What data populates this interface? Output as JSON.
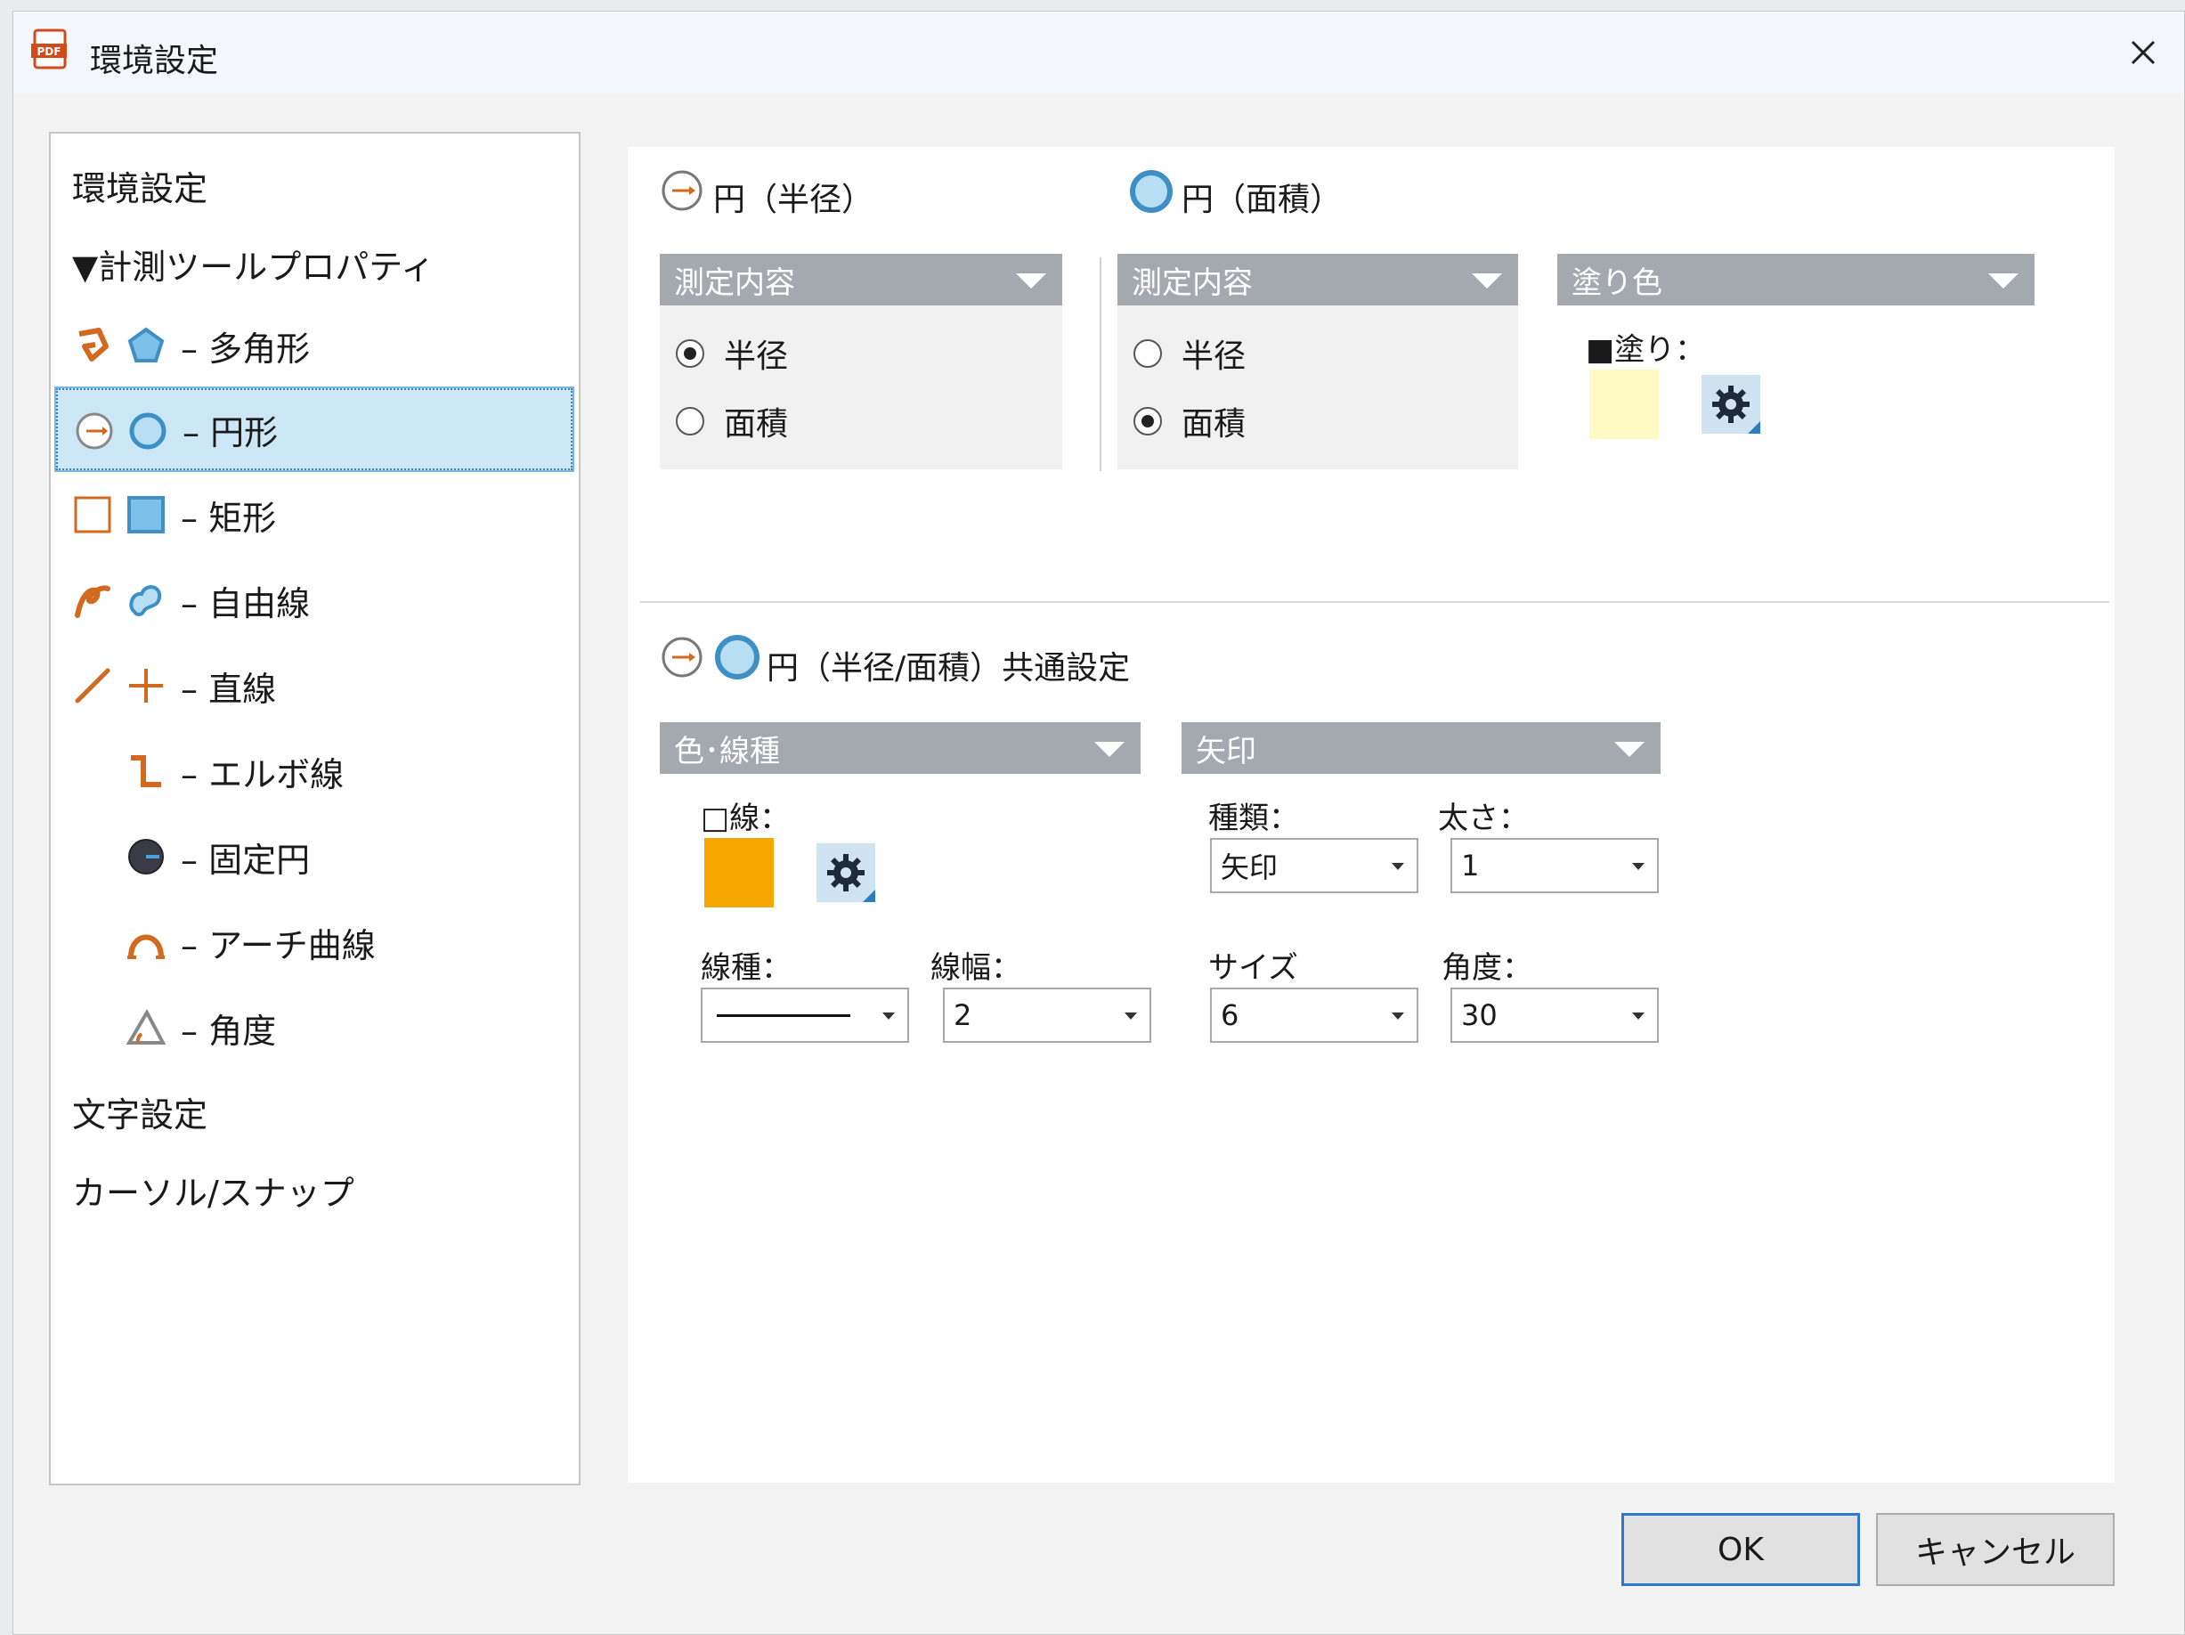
{
  "window": {
    "title": "環境設定"
  },
  "tree": {
    "items": [
      {
        "label": "環境設定"
      },
      {
        "label": "▼計測ツールプロパティ"
      },
      {
        "label": "– 多角形"
      },
      {
        "label": "– 円形"
      },
      {
        "label": "– 矩形"
      },
      {
        "label": "– 自由線"
      },
      {
        "label": "– 直線"
      },
      {
        "label": "– エルボ線"
      },
      {
        "label": "– 固定円"
      },
      {
        "label": "– アーチ曲線"
      },
      {
        "label": "– 角度"
      },
      {
        "label": "文字設定"
      },
      {
        "label": "カーソル/スナップ"
      }
    ]
  },
  "radius_section": {
    "title": "円（半径）",
    "header": "測定内容",
    "options": [
      "半径",
      "面積"
    ],
    "selected": "半径"
  },
  "area_section": {
    "title": "円（面積）",
    "header": "測定内容",
    "options": [
      "半径",
      "面積"
    ],
    "selected": "面積"
  },
  "fill_section": {
    "header": "塗り色",
    "fill_label": "■塗り：",
    "fill_color": "#fff9c4"
  },
  "common_section": {
    "title": "円（半径/面積）共通設定",
    "color_group": {
      "header": "色･線種",
      "line_label": "□線：",
      "line_color": "#f7a800",
      "linetype_label": "線種：",
      "linewidth_label": "線幅：",
      "linewidth_value": "2"
    },
    "arrow_group": {
      "header": "矢印",
      "kind_label": "種類：",
      "kind_value": "矢印",
      "thickness_label": "太さ：",
      "thickness_value": "1",
      "size_label": "サイズ",
      "size_value": "6",
      "angle_label": "角度：",
      "angle_value": "30"
    }
  },
  "footer": {
    "ok": "OK",
    "cancel": "キャンセル"
  },
  "colors": {
    "accent": "#d2691e",
    "blue_icon": "#4aa3d8",
    "selection": "#cce8f7"
  }
}
